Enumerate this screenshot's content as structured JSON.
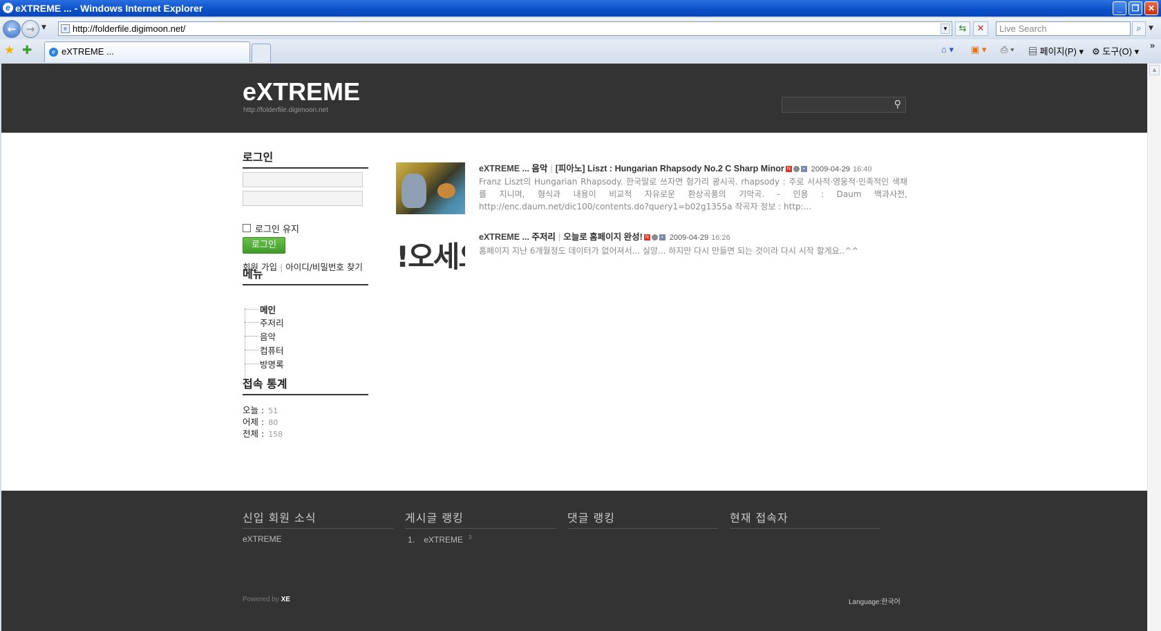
{
  "window": {
    "title": "eXTREME ... - Windows Internet Explorer",
    "url": "http://folderfile.digimoon.net/",
    "live_search_placeholder": "Live Search",
    "tab_label": "eXTREME ...",
    "page_menu": "페이지(P)",
    "tools_menu": "도구(O)"
  },
  "site": {
    "title": "eXTREME",
    "url": "http://folderfile.digimoon.net"
  },
  "sidebar": {
    "login_title": "로그인",
    "keep_login": "로그인 유지",
    "login_button": "로그인",
    "join_link": "회원 가입",
    "find_link": "아이디/비밀번호 찾기",
    "menu_title": "메뉴",
    "menu_items": [
      "메인",
      "주저리",
      "음악",
      "컴퓨터",
      "방명록"
    ],
    "stats_title": "접속 통계",
    "stats": [
      {
        "label": "오늘 :",
        "value": "51"
      },
      {
        "label": "어제 :",
        "value": "80"
      },
      {
        "label": "전체 :",
        "value": "158"
      }
    ]
  },
  "posts": [
    {
      "site": "eXTREME ...",
      "category": "음악",
      "title": "[피아노] Liszt : Hungarian Rhapsody No.2 C Sharp Minor",
      "date": "2009-04-29",
      "time": "16:40",
      "body": "Franz Liszt의 Hungarian Rhapsody. 한국말로 쓰자면 헝가리 광시곡. rhapsody : 주로 서사적·영웅적·민족적인 색채를 지니며, 형식과 내용이 비교적 자유로운 환상곡풍의 기악곡. - 인용 : Daum 백과사전, http://enc.daum.net/dic100/contents.do?query1=b02g1355a 작곡자 정보 : http:..."
    },
    {
      "site": "eXTREME ...",
      "category": "주저리",
      "title": "오늘로 홈페이지 완성!",
      "date": "2009-04-29",
      "time": "16:26",
      "body": "홈페이지 지난 6개월정도 데이터가 없어져서... 실망... 하지만 다시 만들면 되는 것이라 다시 시작 할게요..^^",
      "thumb_text": "!오세오"
    }
  ],
  "footer": {
    "new_members_title": "신입 회원 소식",
    "new_member": "eXTREME",
    "post_rank_title": "게시글 랭킹",
    "post_rank_num": "1.",
    "post_rank_name": "eXTREME",
    "post_rank_count": "3",
    "comment_rank_title": "댓글 랭킹",
    "online_title": "현재 접속자",
    "powered_prefix": "Powered by",
    "powered_name": "XE",
    "language": "Language:한국어"
  },
  "colors": {
    "header_bg": "#333333",
    "login_button": "#4aa830",
    "titlebar": "#0a4fc8"
  }
}
